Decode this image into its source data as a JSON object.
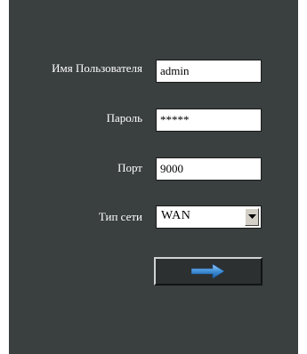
{
  "login": {
    "username_label": "Имя Пользователя",
    "username_value": "admin",
    "password_label": "Пароль",
    "password_value": "*****",
    "port_label": "Порт",
    "port_value": "9000",
    "network_type_label": "Тип сети",
    "network_type_value": "WAN",
    "submit_icon": "right-arrow-icon",
    "dropdown_icon": "triangle-down-icon"
  },
  "colors": {
    "panel_background": "#3a3f3f",
    "text": "#ffffff",
    "arrow_fill": "#3f8fd6"
  }
}
